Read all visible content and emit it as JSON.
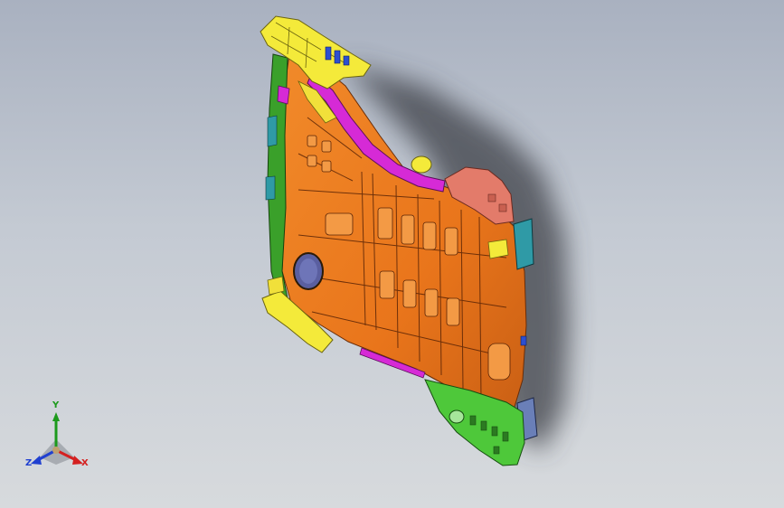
{
  "viewport": {
    "triad": {
      "x_label": "X",
      "y_label": "Y",
      "z_label": "Z",
      "colors": {
        "x": "#d42020",
        "y": "#1c9a1c",
        "z": "#2040d0"
      }
    }
  },
  "model": {
    "colors": {
      "main_panel": "#e9751b",
      "panel_shadow": "#b4551a",
      "top_brackets": "#f4ea3a",
      "left_pillar": "#3aa02a",
      "magenta_reinforcement": "#d62ad6",
      "bottom_corner": "#4ec83a",
      "salmon_plate": "#e37b6a",
      "teal_brackets": "#2f9aa6",
      "blue_clips": "#2c4fd0"
    }
  }
}
